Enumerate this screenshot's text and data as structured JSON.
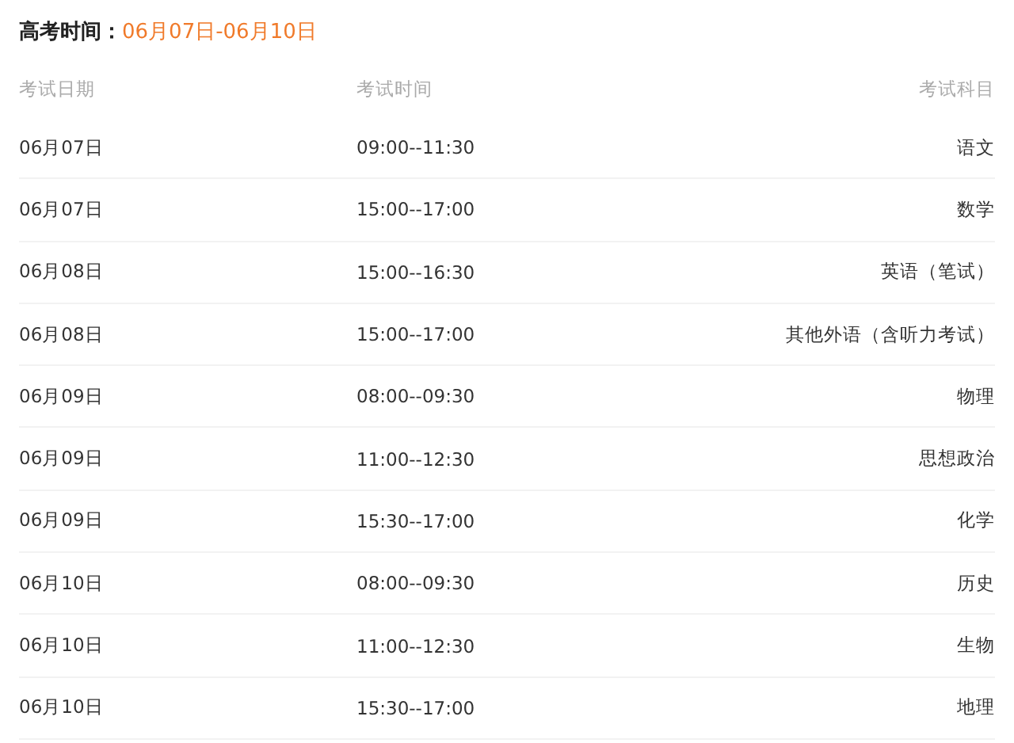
{
  "title": {
    "label": "高考时间：",
    "value": "06月07日-06月10日"
  },
  "table": {
    "columns": [
      "考试日期",
      "考试时间",
      "考试科目"
    ],
    "rows": [
      {
        "date": "06月07日",
        "time": "09:00--11:30",
        "subject": "语文"
      },
      {
        "date": "06月07日",
        "time": "15:00--17:00",
        "subject": "数学"
      },
      {
        "date": "06月08日",
        "time": "15:00--16:30",
        "subject": "英语（笔试）"
      },
      {
        "date": "06月08日",
        "time": "15:00--17:00",
        "subject": "其他外语（含听力考试）"
      },
      {
        "date": "06月09日",
        "time": "08:00--09:30",
        "subject": "物理"
      },
      {
        "date": "06月09日",
        "time": "11:00--12:30",
        "subject": "思想政治"
      },
      {
        "date": "06月09日",
        "time": "15:30--17:00",
        "subject": "化学"
      },
      {
        "date": "06月10日",
        "time": "08:00--09:30",
        "subject": "历史"
      },
      {
        "date": "06月10日",
        "time": "11:00--12:30",
        "subject": "生物"
      },
      {
        "date": "06月10日",
        "time": "15:30--17:00",
        "subject": "地理"
      }
    ]
  }
}
